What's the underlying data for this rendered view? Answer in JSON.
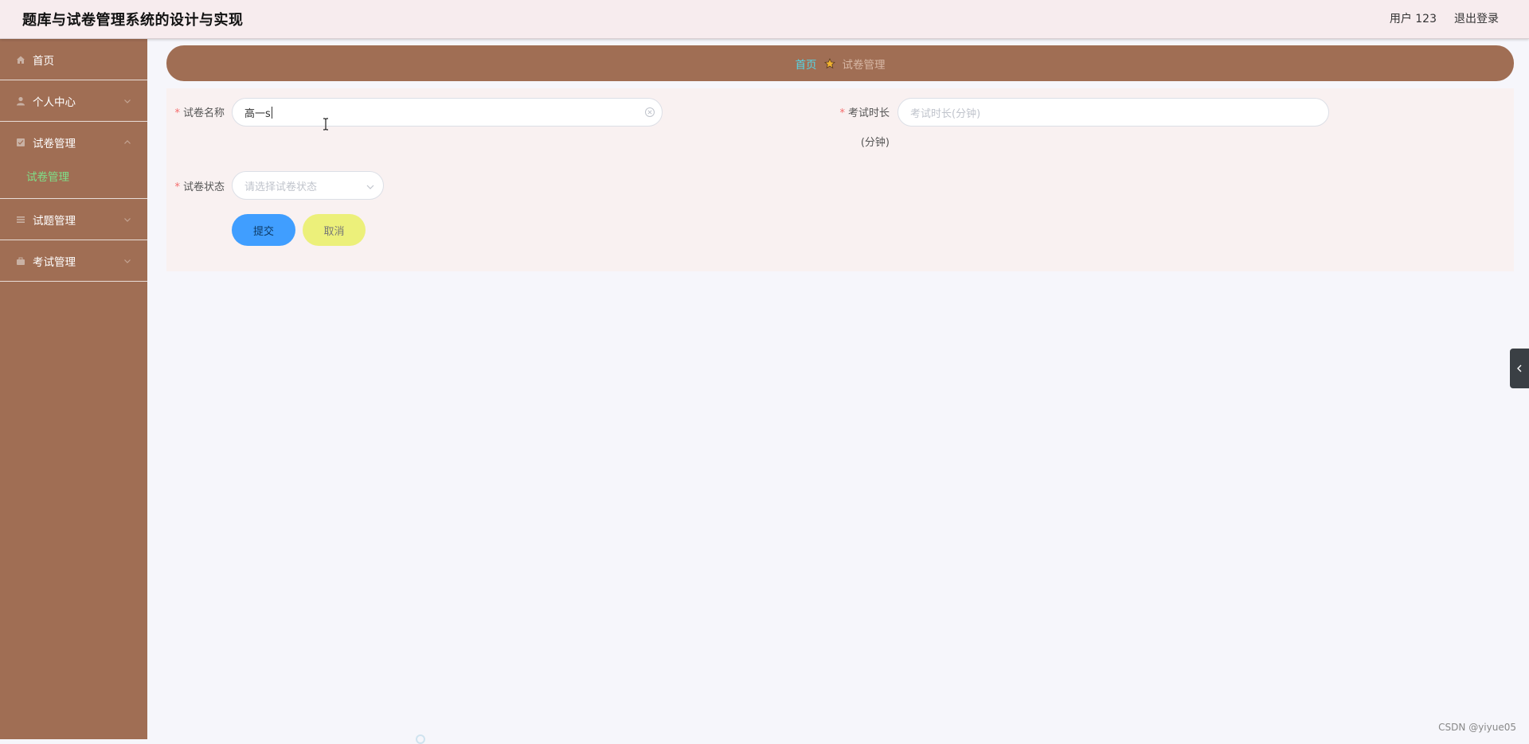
{
  "header": {
    "app_title": "题库与试卷管理系统的设计与实现",
    "user_label": "用户 123",
    "logout_label": "退出登录"
  },
  "sidebar": {
    "items": [
      {
        "label": "首页",
        "icon": "home-icon",
        "expandable": false
      },
      {
        "label": "个人中心",
        "icon": "user-icon",
        "expandable": true
      },
      {
        "label": "试卷管理",
        "icon": "paper-icon",
        "expandable": true,
        "expanded": true,
        "children": [
          {
            "label": "试卷管理",
            "active": true
          }
        ]
      },
      {
        "label": "试题管理",
        "icon": "list-icon",
        "expandable": true
      },
      {
        "label": "考试管理",
        "icon": "briefcase-icon",
        "expandable": true
      }
    ]
  },
  "breadcrumb": {
    "home": "首页",
    "separator_icon": "star-icon",
    "current": "试卷管理"
  },
  "form": {
    "paper_name": {
      "required_mark": "*",
      "label": "试卷名称",
      "value": "高一s",
      "clear_icon": "circle-close-icon"
    },
    "exam_duration": {
      "required_mark": "*",
      "label": "考试时长",
      "label_suffix": "(分钟)",
      "placeholder": "考试时长(分钟)",
      "value": ""
    },
    "paper_status": {
      "required_mark": "*",
      "label": "试卷状态",
      "placeholder": "请选择试卷状态",
      "arrow_icon": "chevron-down-icon"
    },
    "submit_label": "提交",
    "cancel_label": "取消"
  },
  "colors": {
    "sidebar_bg": "#a06e54",
    "header_bg": "#f7ecee",
    "submenu_active": "#7ee089",
    "breadcrumb_home": "#54d7e8",
    "submit_bg": "#409eff",
    "cancel_bg": "#ecf07a"
  },
  "watermark": "CSDN @yiyue05"
}
